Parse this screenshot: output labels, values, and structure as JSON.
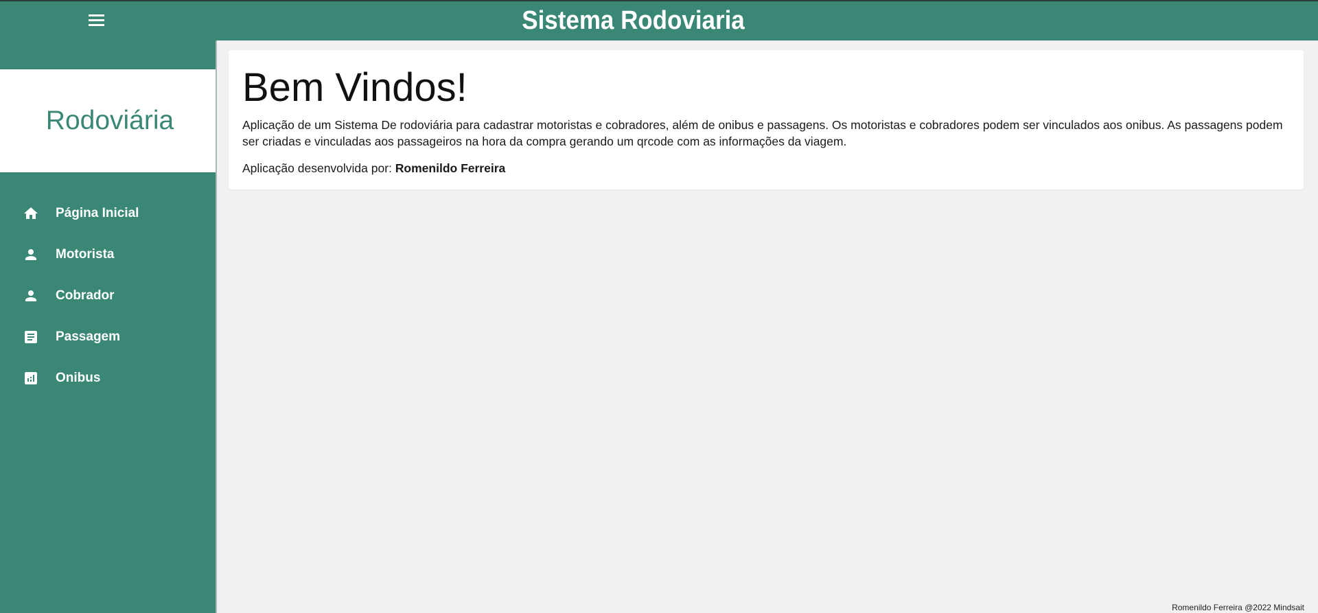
{
  "header": {
    "title": "Sistema Rodoviaria",
    "menu_icon": "menu-icon"
  },
  "sidebar": {
    "brand": "Rodoviária",
    "items": [
      {
        "label": "Página Inicial",
        "icon": "home-icon"
      },
      {
        "label": "Motorista",
        "icon": "person-icon"
      },
      {
        "label": "Cobrador",
        "icon": "person-icon"
      },
      {
        "label": "Passagem",
        "icon": "receipt-icon"
      },
      {
        "label": "Onibus",
        "icon": "analytics-icon"
      }
    ]
  },
  "main": {
    "heading": "Bem Vindos!",
    "description": "Aplicação de um Sistema De rodoviária para cadastrar motoristas e cobradores, além de onibus e passagens. Os motoristas e cobradores podem ser vinculados aos onibus. As passagens podem ser criadas e vinculadas aos passageiros na hora da compra gerando um qrcode com as informações da viagem.",
    "credit_prefix": "Aplicação desenvolvida por:",
    "credit_author": "Romenildo Ferreira"
  },
  "footer": {
    "text": "Romenildo Ferreira @2022 Mindsait"
  },
  "colors": {
    "primary": "#3a8776",
    "background": "#f1f1f3",
    "card": "#ffffff"
  }
}
